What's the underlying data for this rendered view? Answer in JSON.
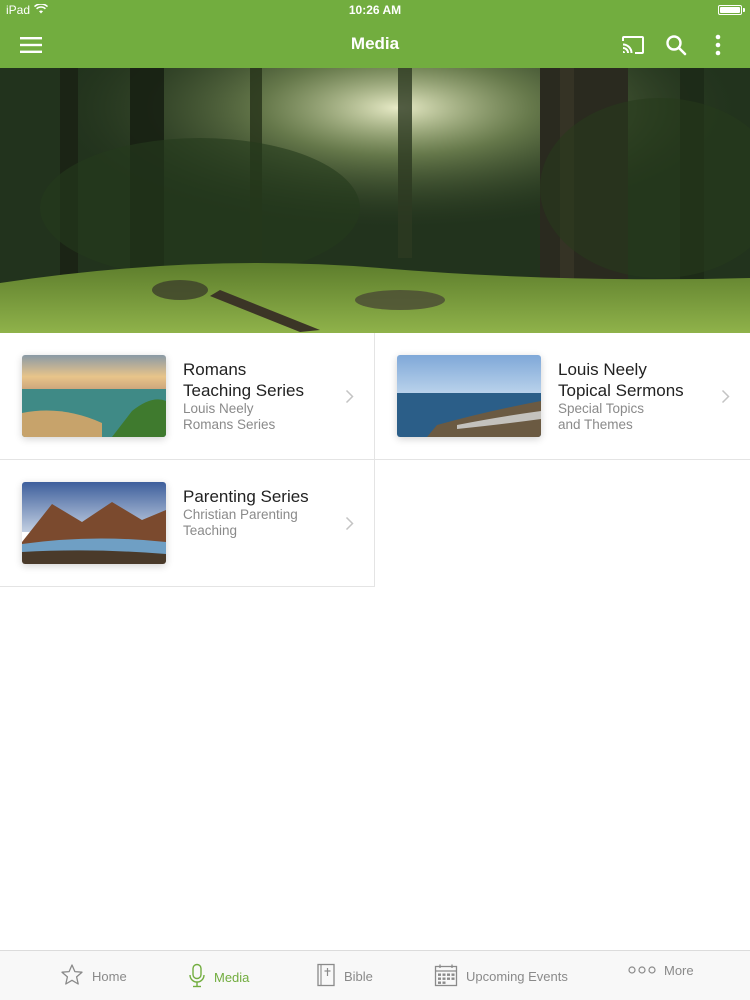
{
  "status_bar": {
    "device": "iPad",
    "time": "10:26 AM"
  },
  "nav": {
    "title": "Media",
    "icons": [
      "hamburger-menu-icon",
      "cast-icon",
      "search-icon",
      "more-vertical-icon"
    ]
  },
  "colors": {
    "brand": "#72ad3f",
    "tab_active": "#72ad3f",
    "tab_inactive": "#8a8a8a"
  },
  "series": [
    {
      "title_line1": "Romans",
      "title_line2": "Teaching Series",
      "sub_line1": "Louis Neely",
      "sub_line2": "Romans Series",
      "thumb": "coast-sunset-thumbnail"
    },
    {
      "title_line1": "Louis Neely",
      "title_line2": "Topical Sermons",
      "sub_line1": "Special Topics",
      "sub_line2": "and Themes",
      "thumb": "rocky-shore-thumbnail"
    },
    {
      "title_line1": "Parenting Series",
      "title_line2": "",
      "sub_line1": "Christian Parenting",
      "sub_line2": "Teaching",
      "thumb": "mountain-river-thumbnail"
    }
  ],
  "tabs": [
    {
      "label": "Home",
      "icon": "star-icon",
      "active": false
    },
    {
      "label": "Media",
      "icon": "microphone-icon",
      "active": true
    },
    {
      "label": "Bible",
      "icon": "bible-icon",
      "active": false
    },
    {
      "label": "Upcoming Events",
      "icon": "calendar-icon",
      "active": false
    },
    {
      "label": "More",
      "icon": "more-dots-icon",
      "active": false
    }
  ]
}
